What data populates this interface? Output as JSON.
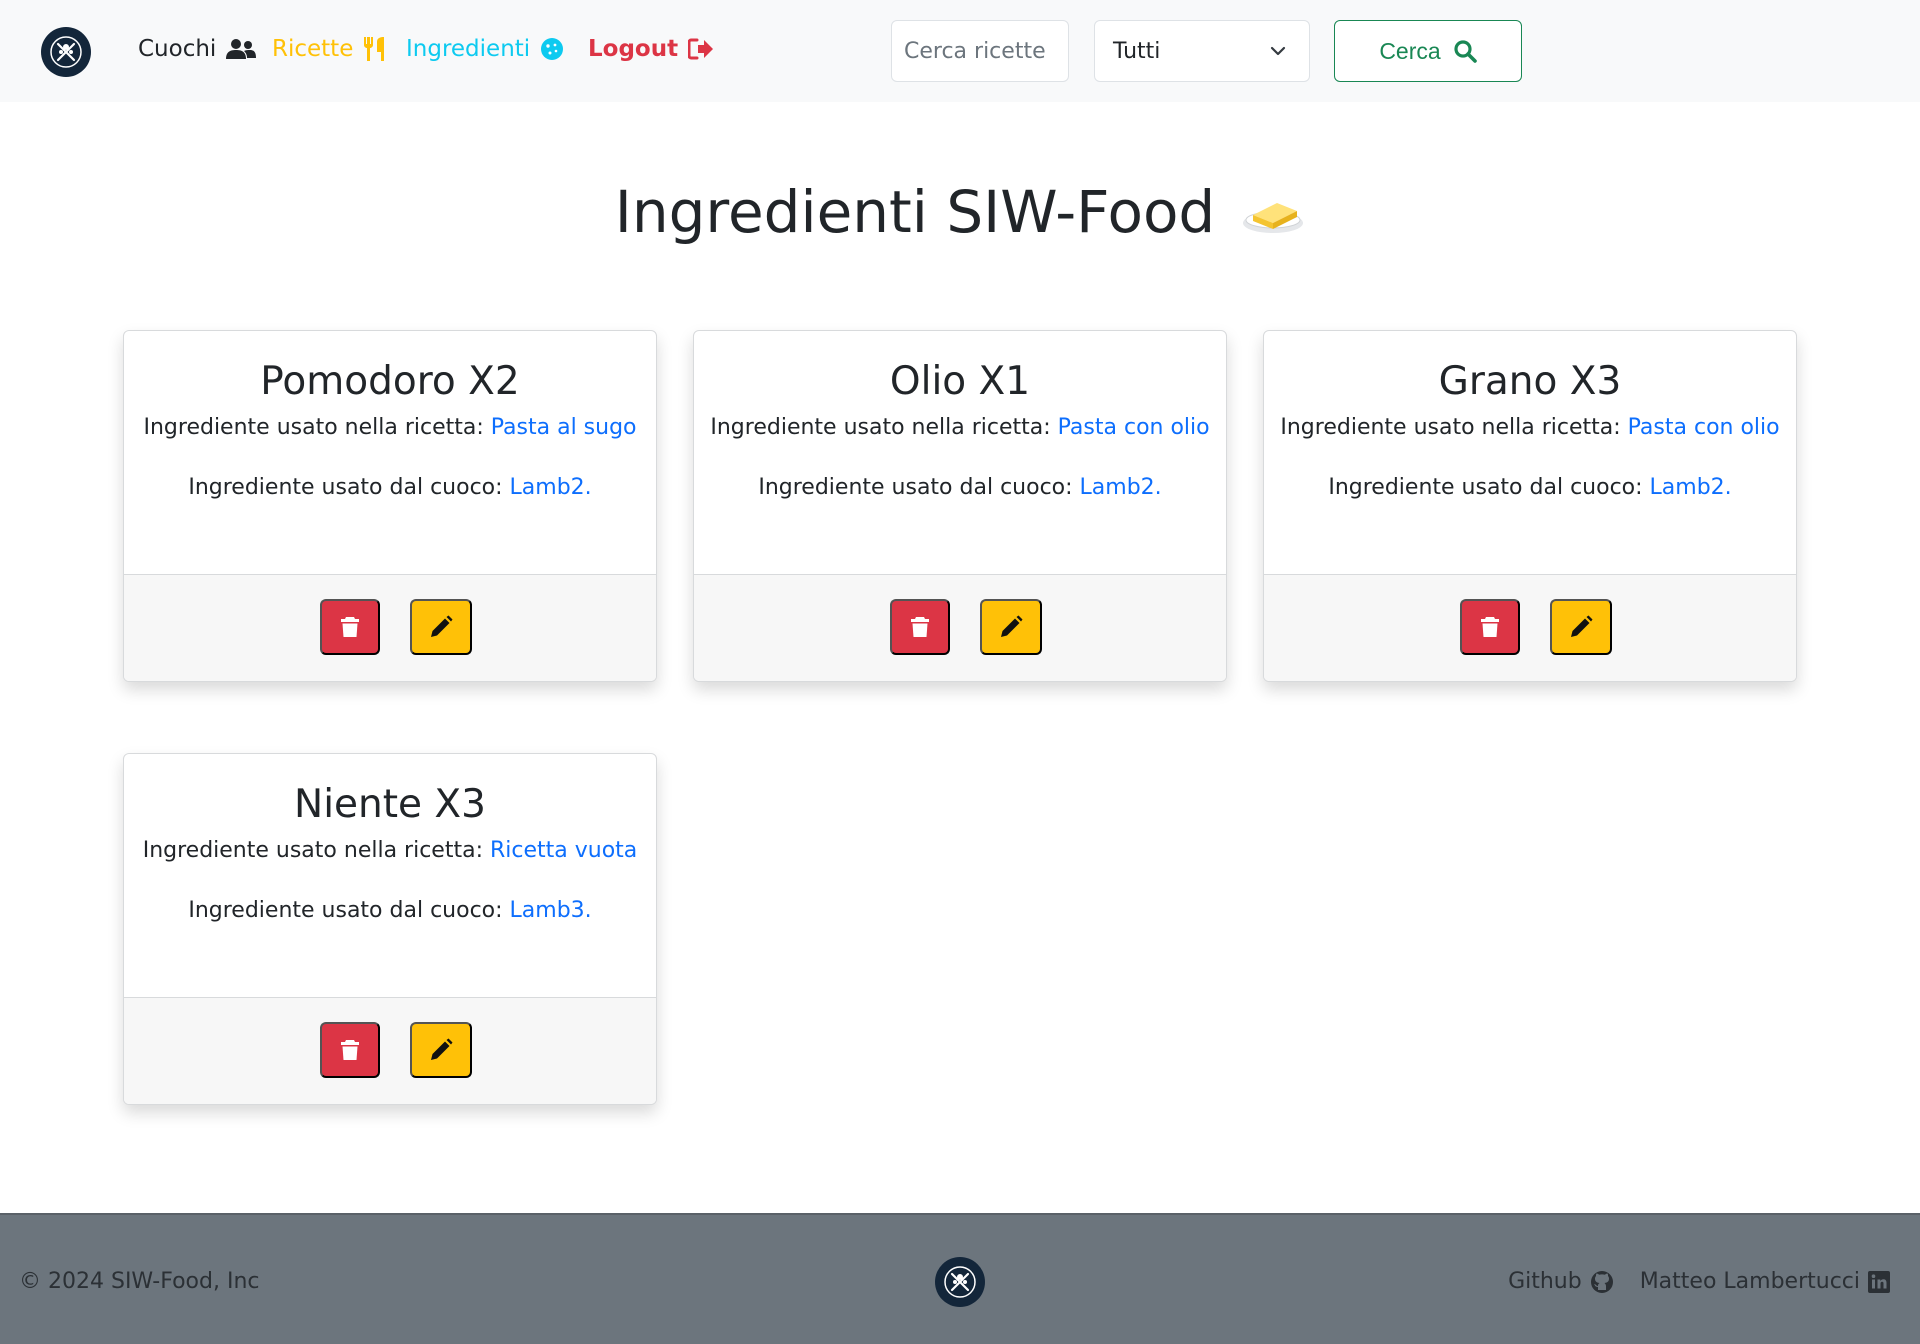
{
  "nav": {
    "cuochi": "Cuochi",
    "ricette": "Ricette",
    "ingredienti": "Ingredienti",
    "logout": "Logout",
    "search_placeholder": "Cerca ricette",
    "select_value": "Tutti",
    "search_button": "Cerca"
  },
  "page": {
    "title": "Ingredienti SIW-Food"
  },
  "labels": {
    "recipe_prefix": "Ingrediente usato nella ricetta: ",
    "cook_prefix": "Ingrediente usato dal cuoco: "
  },
  "cards": [
    {
      "title": "Pomodoro X2",
      "recipe": "Pasta al sugo",
      "cook": "Lamb2."
    },
    {
      "title": "Olio X1",
      "recipe": "Pasta con olio",
      "cook": "Lamb2."
    },
    {
      "title": "Grano X3",
      "recipe": "Pasta con olio",
      "cook": "Lamb2."
    },
    {
      "title": "Niente X3",
      "recipe": "Ricetta vuota",
      "cook": "Lamb3."
    }
  ],
  "footer": {
    "copyright": "© 2024 SIW-Food, Inc",
    "github": "Github",
    "author": "Matteo Lambertucci"
  },
  "icons": {
    "cuochi": "users-icon",
    "ricette": "utensils-icon",
    "ingredienti": "cookie-icon",
    "logout": "sign-out-icon",
    "search": "search-icon",
    "title": "butter-icon",
    "delete": "trash-icon",
    "edit": "pencil-icon",
    "github": "github-icon",
    "linkedin": "linkedin-icon"
  },
  "colors": {
    "navbar_bg": "#f8f9fa",
    "warning": "#ffc107",
    "info": "#0dcaf0",
    "danger": "#dc3545",
    "success": "#198754",
    "link": "#0d6efd",
    "footer_bg": "#6c757d"
  }
}
